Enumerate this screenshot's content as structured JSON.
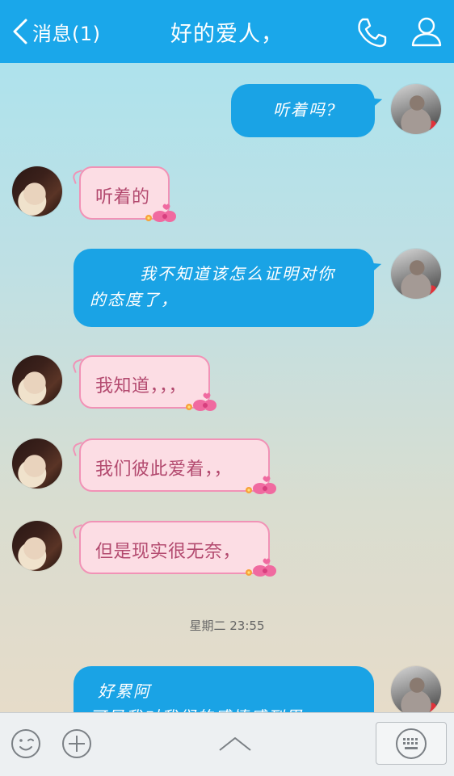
{
  "header": {
    "back_label": "消息(1)",
    "title": "好的爱人，"
  },
  "messages": [
    {
      "from": "me",
      "text": "听着吗?"
    },
    {
      "from": "her",
      "text": "听着的"
    },
    {
      "from": "me",
      "text_line1": "我不知道该怎么证明对你",
      "text_line2": "的态度了，"
    },
    {
      "from": "her",
      "text": "我知道，，，"
    },
    {
      "from": "her",
      "text": "我们彼此爱着，，"
    },
    {
      "from": "her",
      "text": "但是现实很无奈，"
    },
    {
      "from": "me",
      "text_line1": "好累阿",
      "text_line2": "可是我对我们的感情感到累"
    }
  ],
  "timestamp": "星期二 23:55",
  "colors": {
    "header_bg": "#1aa7ea",
    "sent_bubble": "#1aa3e5",
    "received_bubble": "#fcdde4",
    "received_border": "#f192b6",
    "received_text": "#b34a6f"
  }
}
